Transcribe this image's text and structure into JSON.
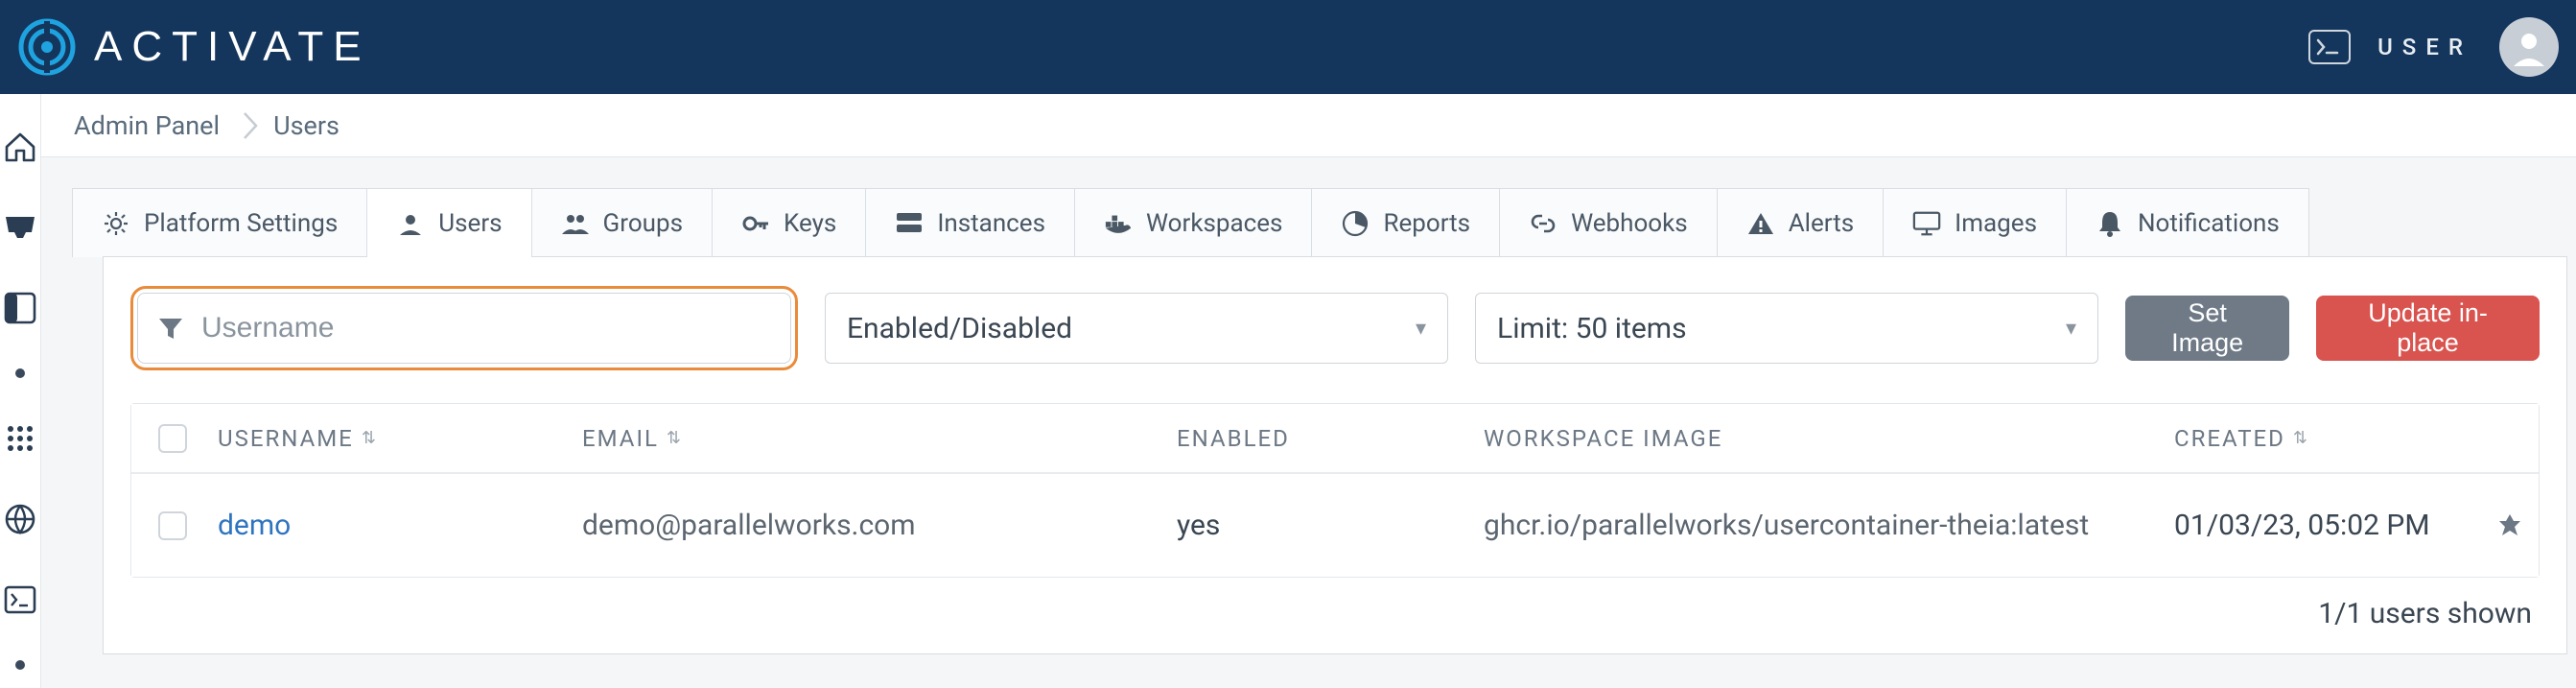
{
  "header": {
    "brand": "ACTIVATE",
    "user_label": "USER"
  },
  "breadcrumb": {
    "items": [
      "Admin Panel",
      "Users"
    ]
  },
  "tabs": [
    {
      "icon": "gear-icon",
      "label": "Platform Settings"
    },
    {
      "icon": "user-icon",
      "label": "Users"
    },
    {
      "icon": "group-icon",
      "label": "Groups"
    },
    {
      "icon": "key-icon",
      "label": "Keys"
    },
    {
      "icon": "server-icon",
      "label": "Instances"
    },
    {
      "icon": "docker-icon",
      "label": "Workspaces"
    },
    {
      "icon": "pie-icon",
      "label": "Reports"
    },
    {
      "icon": "link-icon",
      "label": "Webhooks"
    },
    {
      "icon": "alert-icon",
      "label": "Alerts"
    },
    {
      "icon": "monitor-icon",
      "label": "Images"
    },
    {
      "icon": "bell-icon",
      "label": "Notifications"
    }
  ],
  "active_tab_index": 1,
  "filters": {
    "username_placeholder": "Username",
    "enabled_select": "Enabled/Disabled",
    "limit_select": "Limit: 50 items"
  },
  "buttons": {
    "set_image": "Set Image",
    "update_inplace": "Update in-place"
  },
  "table": {
    "columns": [
      "USERNAME",
      "EMAIL",
      "ENABLED",
      "WORKSPACE IMAGE",
      "CREATED"
    ],
    "rows": [
      {
        "username": "demo",
        "email": "demo@parallelworks.com",
        "enabled": "yes",
        "workspace_image": "ghcr.io/parallelworks/usercontainer-theia:latest",
        "created": "01/03/23, 05:02 PM"
      }
    ],
    "footer": "1/1 users shown"
  }
}
